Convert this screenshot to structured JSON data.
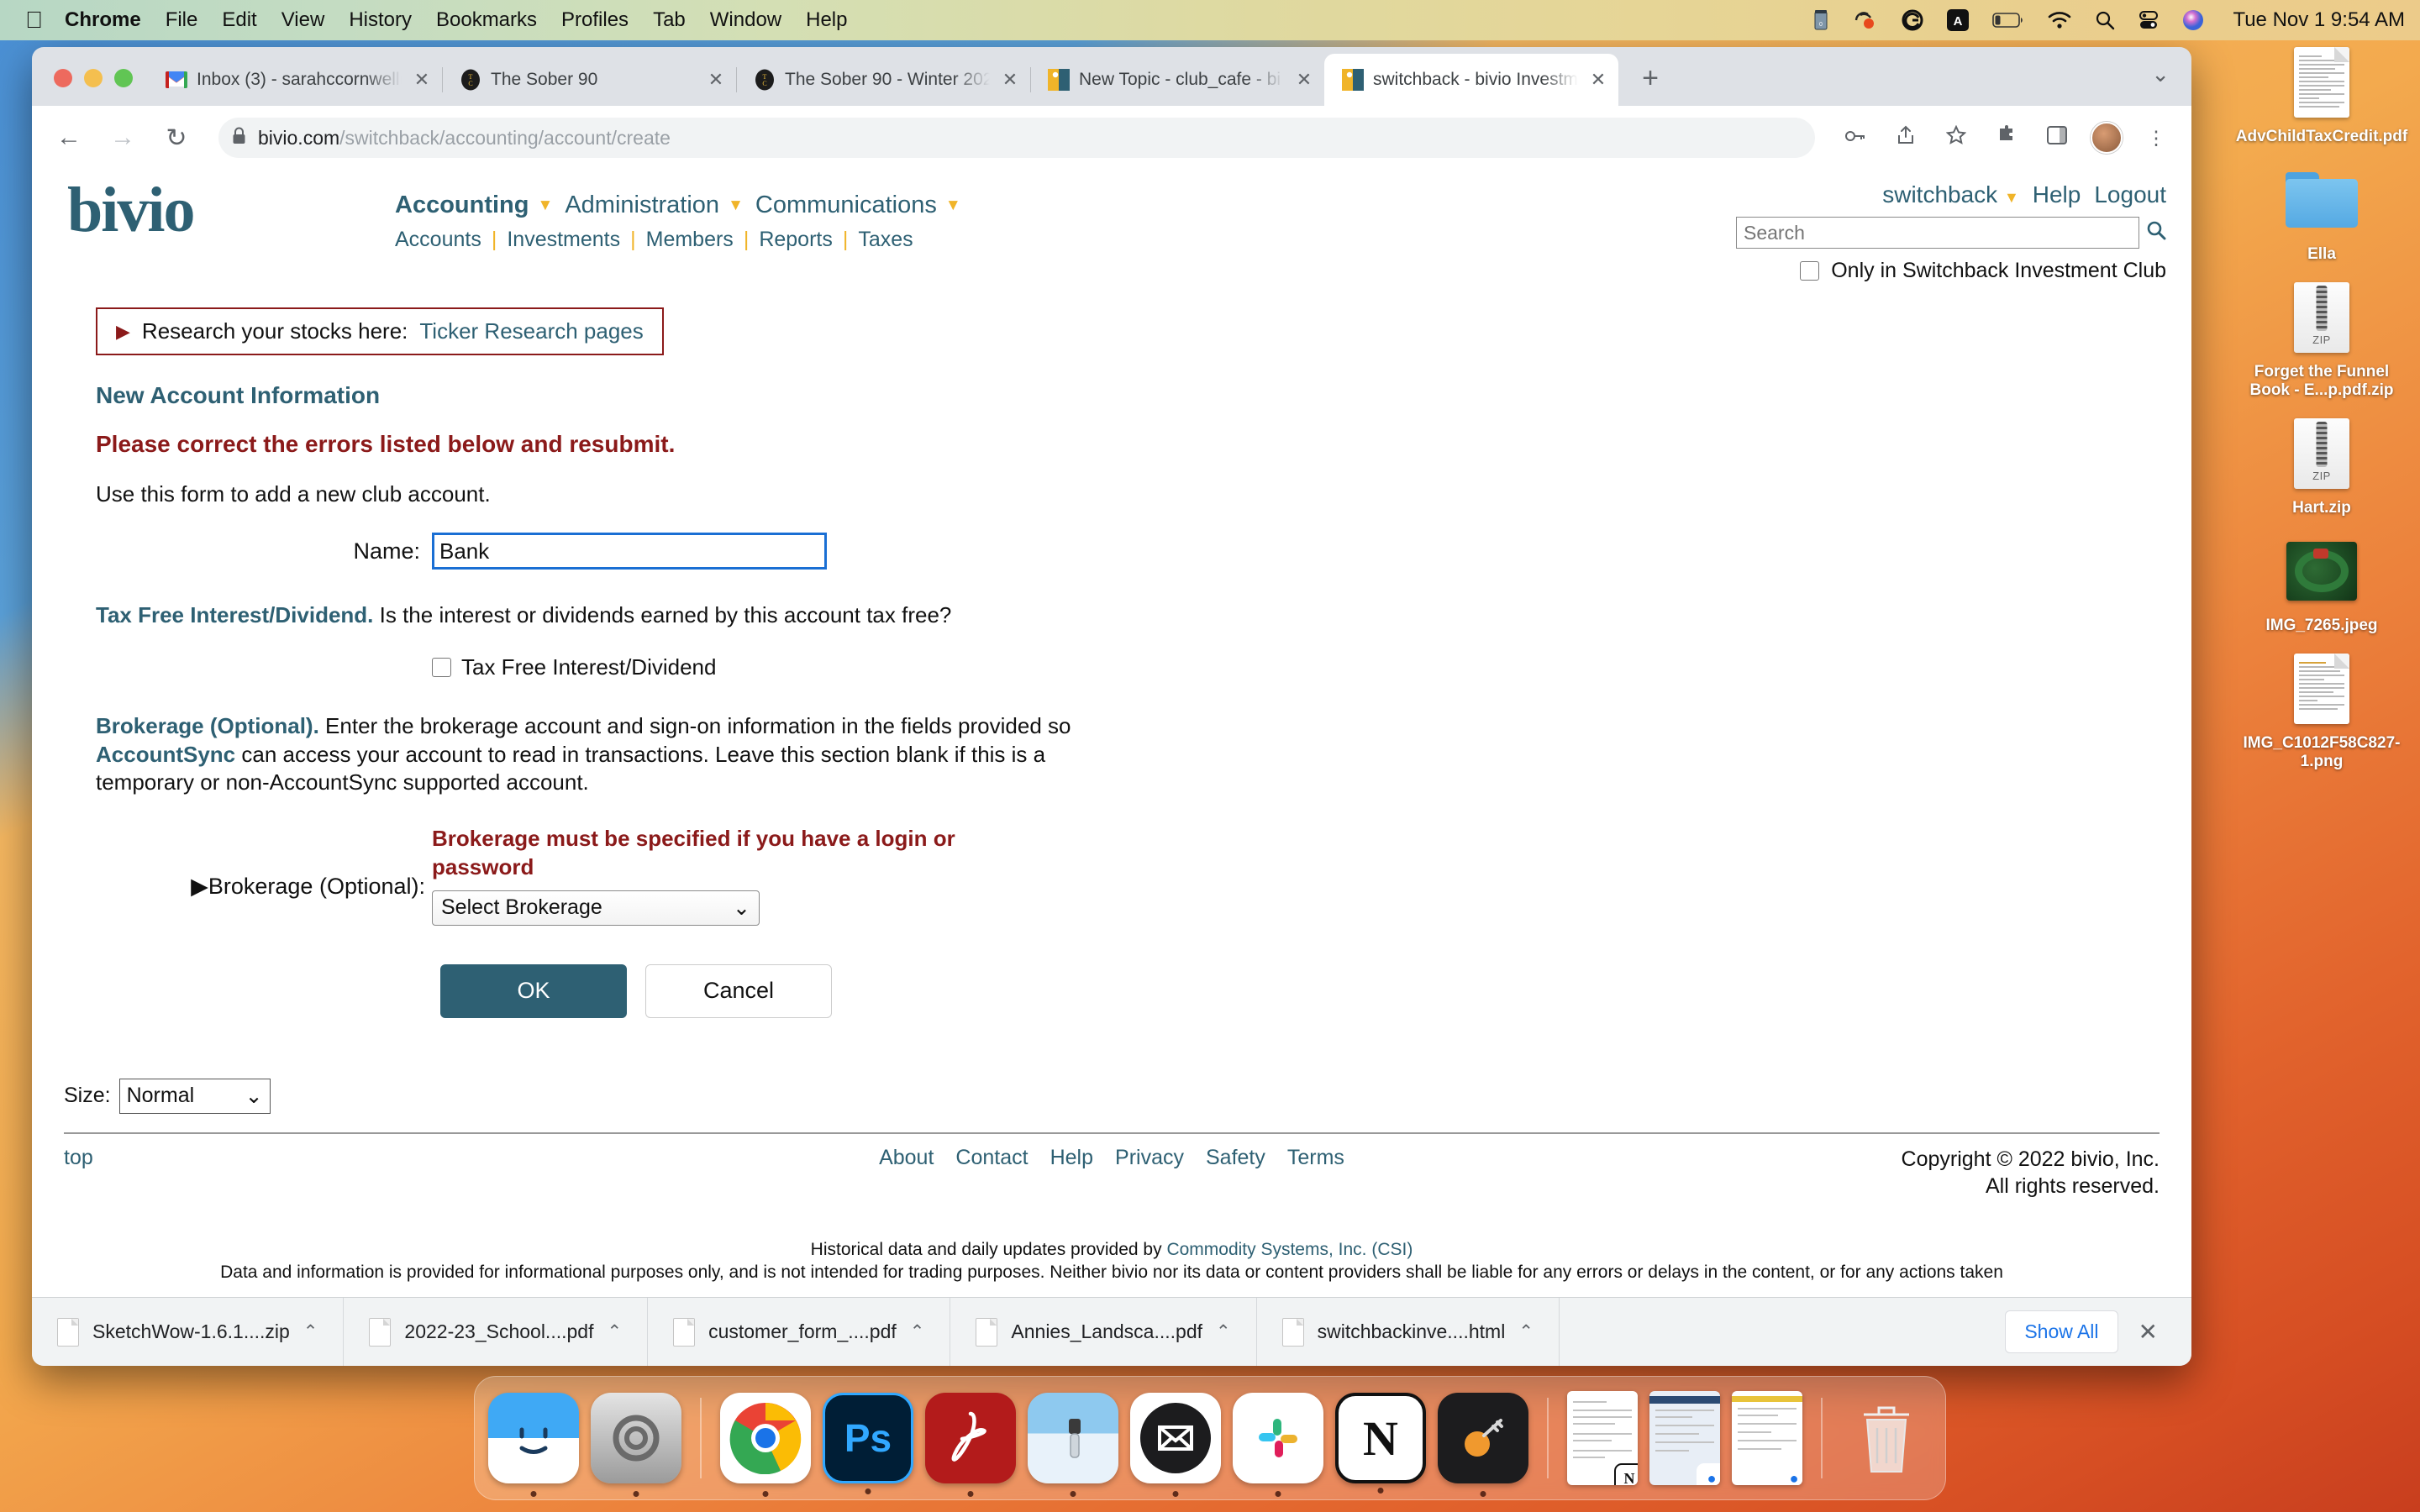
{
  "menubar": {
    "apple_icon": "apple-icon",
    "items": [
      "Chrome",
      "File",
      "Edit",
      "View",
      "History",
      "Bookmarks",
      "Profiles",
      "Tab",
      "Window",
      "Help"
    ],
    "status_icons": [
      "battery-stats-icon",
      "onepassword-icon",
      "grammarly-icon",
      "input-source-icon",
      "battery-icon",
      "wifi-icon",
      "spotlight-search-icon",
      "control-center-icon",
      "siri-icon"
    ],
    "clock": "Tue Nov 1  9:54 AM"
  },
  "browser": {
    "tabs": [
      {
        "title": "Inbox (3) - sarahccornwell(",
        "favicon": "gmail-icon",
        "active": false
      },
      {
        "title": "The Sober 90",
        "favicon": "tlc-icon",
        "active": false
      },
      {
        "title": "The Sober 90 - Winter 202",
        "favicon": "tlc-icon",
        "active": false
      },
      {
        "title": "New Topic - club_cafe - bi",
        "favicon": "bivio-icon",
        "active": false
      },
      {
        "title": "switchback - bivio Investm",
        "favicon": "bivio-icon",
        "active": true
      }
    ],
    "tab_close_label": "✕",
    "new_tab_label": "+",
    "tab_list_chevron": "⌄",
    "back_icon": "←",
    "forward_icon": "→",
    "reload_icon": "↻",
    "lock_icon": "lock-icon",
    "url_domain": "bivio.com",
    "url_path": "/switchback/accounting/account/create",
    "omnibox_icons": [
      "password-key-icon",
      "share-icon",
      "bookmark-star-icon",
      "extensions-puzzle-icon",
      "side-panel-icon"
    ],
    "profile_avatar": "profile-avatar"
  },
  "bivio": {
    "logo_text": "bivio",
    "nav_primary": [
      {
        "label": "Accounting",
        "bold": true,
        "caret": "▼"
      },
      {
        "label": "Administration",
        "bold": false,
        "caret": "▼"
      },
      {
        "label": "Communications",
        "bold": false,
        "caret": "▼"
      }
    ],
    "nav_secondary": [
      "Accounts",
      "Investments",
      "Members",
      "Reports",
      "Taxes"
    ],
    "account_menu": {
      "label": "switchback",
      "caret": "▼"
    },
    "help_label": "Help",
    "logout_label": "Logout",
    "search_placeholder": "Search",
    "search_icon": "search-magnifier-icon",
    "only_in_club_label": "Only in Switchback Investment Club",
    "only_in_club_checked": false
  },
  "main": {
    "notice_prefix": "Research your stocks here:",
    "notice_link": "Ticker Research pages",
    "notice_marker": "▶",
    "section_title": "New Account Information",
    "error_banner": "Please correct the errors listed below and resubmit.",
    "intro": "Use this form to add a new club account.",
    "name_label": "Name:",
    "name_value": "Bank",
    "tax_free_heading": "Tax Free Interest/Dividend.",
    "tax_free_question": "Is the interest or dividends earned by this account tax free?",
    "tax_free_checkbox_label": "Tax Free Interest/Dividend",
    "tax_free_checked": false,
    "brokerage_heading": "Brokerage (Optional).",
    "brokerage_p1": " Enter the brokerage account and sign-on information in the fields provided so ",
    "brokerage_accountsync": "AccountSync",
    "brokerage_p2": " can access your account to read in transactions. Leave this section blank if this is a temporary or non-AccountSync supported account.",
    "brokerage_error": "Brokerage must be specified if you have a login or password",
    "brokerage_label": "▶Brokerage (Optional):",
    "brokerage_selected": "Select Brokerage",
    "select_chevron": "⌄",
    "ok_label": "OK",
    "cancel_label": "Cancel"
  },
  "footer": {
    "size_label": "Size:",
    "size_value": "Normal",
    "top_label": "top",
    "links": [
      "About",
      "Contact",
      "Help",
      "Privacy",
      "Safety",
      "Terms"
    ],
    "copyright_line1": "Copyright © 2022 bivio, Inc.",
    "copyright_line2": "All rights reserved.",
    "disclaimer_pre": "Historical data and daily updates provided by ",
    "disclaimer_link": "Commodity Systems, Inc. (CSI)",
    "disclaimer_rest": "Data and information is provided for informational purposes only, and is not intended for trading purposes. Neither bivio nor its data or content providers shall be liable for any errors or delays in the content, or for any actions taken"
  },
  "downloads": {
    "items": [
      {
        "name": "SketchWow-1.6.1....zip",
        "icon": "zip-file-icon"
      },
      {
        "name": "2022-23_School....pdf",
        "icon": "pdf-file-icon"
      },
      {
        "name": "customer_form_....pdf",
        "icon": "pdf-file-icon"
      },
      {
        "name": "Annies_Landsca....pdf",
        "icon": "pdf-file-icon"
      },
      {
        "name": "switchbackinve....html",
        "icon": "html-file-icon"
      }
    ],
    "chevron": "⌃",
    "show_all_label": "Show All",
    "close_label": "✕"
  },
  "desktop": {
    "icons": [
      {
        "label": "AdvChildTaxCredit.pdf",
        "type": "document",
        "name": "desktop-icon-advchildtaxcredit-pdf"
      },
      {
        "label": "Ella",
        "type": "folder",
        "name": "desktop-icon-ella-folder"
      },
      {
        "label": "Forget the Funnel Book - E...p.pdf.zip",
        "type": "zip",
        "name": "desktop-icon-forget-the-funnel-zip"
      },
      {
        "label": "Hart.zip",
        "type": "zip",
        "name": "desktop-icon-hart-zip"
      },
      {
        "label": "IMG_7265.jpeg",
        "type": "photo",
        "name": "desktop-icon-img-7265-jpeg"
      },
      {
        "label": "IMG_C1012F58C827-1.png",
        "type": "document",
        "name": "desktop-icon-img-c1012f58c827-png"
      }
    ]
  },
  "dock": {
    "apps": [
      {
        "name": "finder-icon",
        "glyph": "☺",
        "bg": "linear-gradient(180deg,#3fa9f5 0 50%,#ffffff 50% 100%)",
        "color": "#1a3a5c",
        "running": true
      },
      {
        "name": "system-settings-icon",
        "glyph": "⚙",
        "bg": "linear-gradient(180deg,#dcdcdc,#9e9e9e)",
        "color": "#555",
        "running": false
      },
      {
        "name": "google-chrome-icon",
        "glyph": "●",
        "bg": "conic-gradient(#ea4335 0 33%,#fbbc05 33% 50%,#34a853 50% 75%,#ea4335 75% 100%)",
        "color": "#1a73e8",
        "running": true
      },
      {
        "name": "photoshop-icon",
        "glyph": "Ps",
        "bg": "#001e36",
        "color": "#31a8ff",
        "running": true
      },
      {
        "name": "adobe-acrobat-icon",
        "glyph": "✒",
        "bg": "#b31b1b",
        "color": "#ffffff",
        "running": true
      },
      {
        "name": "preview-icon",
        "glyph": "🔍",
        "bg": "linear-gradient(180deg,#9fd3f2,#dfeef8)",
        "color": "#335",
        "running": true
      },
      {
        "name": "mailbird-icon",
        "glyph": "✉",
        "bg": "#1c1c1e",
        "color": "#ffffff",
        "running": true
      },
      {
        "name": "slack-icon",
        "glyph": "#",
        "bg": "#ffffff",
        "color": "#4a154b",
        "running": true
      },
      {
        "name": "notion-icon",
        "glyph": "N",
        "bg": "#ffffff",
        "color": "#111111",
        "running": true
      },
      {
        "name": "keychain-access-icon",
        "glyph": "🗝",
        "bg": "#1c1c1e",
        "color": "#f5a623",
        "running": true
      }
    ],
    "minimized": [
      {
        "name": "minimized-window-notion",
        "badge": "N",
        "badge_bg": "#ffffff",
        "badge_color": "#111"
      },
      {
        "name": "minimized-window-chrome-1",
        "badge": "●",
        "badge_bg": "#ffffff",
        "badge_color": "#1a73e8"
      },
      {
        "name": "minimized-window-chrome-2",
        "badge": "●",
        "badge_bg": "#ffffff",
        "badge_color": "#1a73e8"
      }
    ],
    "trash": {
      "name": "trash-icon",
      "glyph": "🗑"
    }
  }
}
